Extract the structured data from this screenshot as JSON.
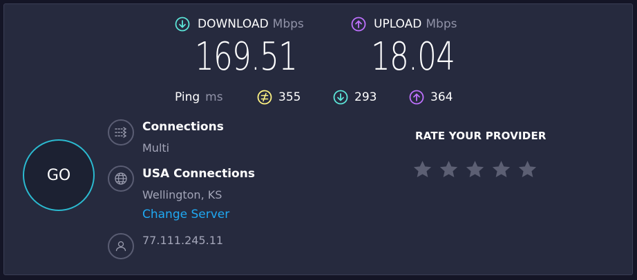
{
  "download": {
    "label": "DOWNLOAD",
    "unit": "Mbps",
    "value": "169.51",
    "icon": "arrow-down-circle-icon",
    "color": "#5ce6d9"
  },
  "upload": {
    "label": "UPLOAD",
    "unit": "Mbps",
    "value": "18.04",
    "icon": "arrow-up-circle-icon",
    "color": "#bf71ff"
  },
  "ping": {
    "label": "Ping",
    "unit": "ms",
    "idle": {
      "value": "355",
      "icon": "ping-idle-icon",
      "color": "#fff383"
    },
    "download": {
      "value": "293",
      "icon": "arrow-down-circle-icon",
      "color": "#5ce6d9"
    },
    "upload": {
      "value": "364",
      "icon": "arrow-up-circle-icon",
      "color": "#bf71ff"
    }
  },
  "go_label": "GO",
  "connections": {
    "title": "Connections",
    "value": "Multi",
    "icon": "connections-icon"
  },
  "server": {
    "title": "USA Connections",
    "location": "Wellington, KS",
    "change_label": "Change Server",
    "icon": "globe-icon"
  },
  "client": {
    "ip": "77.111.245.11",
    "icon": "user-icon"
  },
  "rating": {
    "title": "RATE YOUR PROVIDER",
    "star_count": 5,
    "filled": 0
  },
  "colors": {
    "accent": "#1fa9f3",
    "go_ring": "#2bbad0",
    "panel": "#262a3e",
    "star": "#5c5f73"
  }
}
